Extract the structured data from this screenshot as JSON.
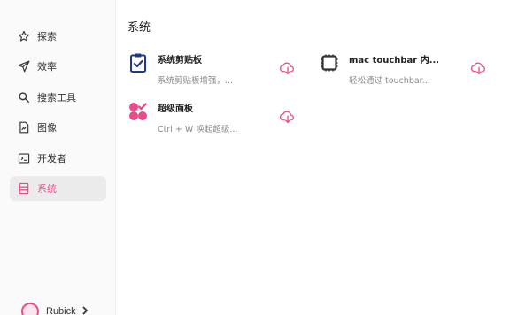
{
  "sidebar": {
    "items": [
      {
        "label": "探索",
        "icon": "star-icon"
      },
      {
        "label": "效率",
        "icon": "send-icon"
      },
      {
        "label": "搜索工具",
        "icon": "search-icon"
      },
      {
        "label": "图像",
        "icon": "image-file-icon"
      },
      {
        "label": "开发者",
        "icon": "terminal-icon"
      },
      {
        "label": "系统",
        "icon": "list-box-icon",
        "active": true
      }
    ],
    "user": {
      "name": "Rubick"
    }
  },
  "main": {
    "section_title": "系统",
    "plugins": [
      {
        "name": "系统剪贴板",
        "desc": "系统剪贴板增强，...",
        "icon": "clipboard-check-icon"
      },
      {
        "name": "mac touchbar 内...",
        "desc": "轻松通过 touchbar...",
        "icon": "chip-icon"
      },
      {
        "name": "超级面板",
        "desc": "Ctrl + W 唤起超级...",
        "icon": "super-panel-icon"
      }
    ]
  },
  "colors": {
    "accent": "#ea4c89",
    "active_bg": "#ebebeb",
    "sidebar_bg": "#fafafa",
    "muted_text": "#8a8a8a"
  }
}
